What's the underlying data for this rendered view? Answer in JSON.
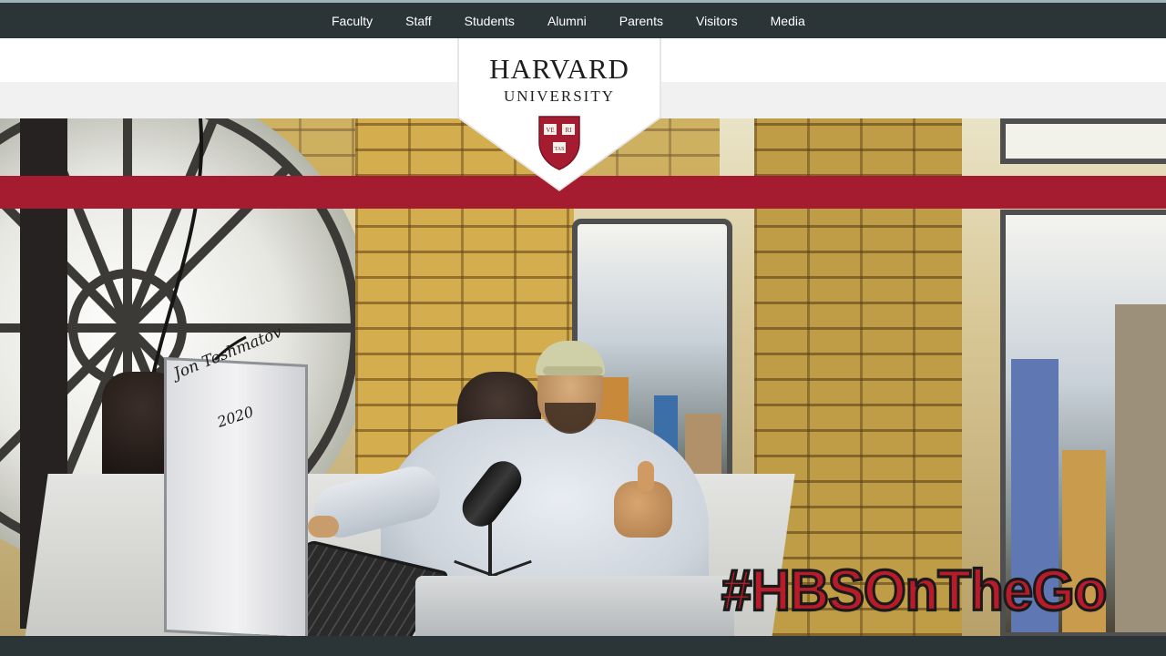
{
  "nav": {
    "items": [
      {
        "label": "Faculty"
      },
      {
        "label": "Staff"
      },
      {
        "label": "Students"
      },
      {
        "label": "Alumni"
      },
      {
        "label": "Parents"
      },
      {
        "label": "Visitors"
      },
      {
        "label": "Media"
      }
    ]
  },
  "header": {
    "title": "HARVARD",
    "subtitle": "UNIVERSITY",
    "shield_text": [
      "VE",
      "RI",
      "TAS"
    ]
  },
  "photo": {
    "signature_name": "Jon Toshmatov",
    "signature_year": "2020",
    "hashtag": "#HBSOnTheGo"
  },
  "colors": {
    "nav_bg": "#2b3537",
    "accent_crimson": "#a51c30",
    "hashtag_red": "#b81b2a"
  },
  "icons": {
    "crest": "harvard-veritas-shield-icon"
  }
}
